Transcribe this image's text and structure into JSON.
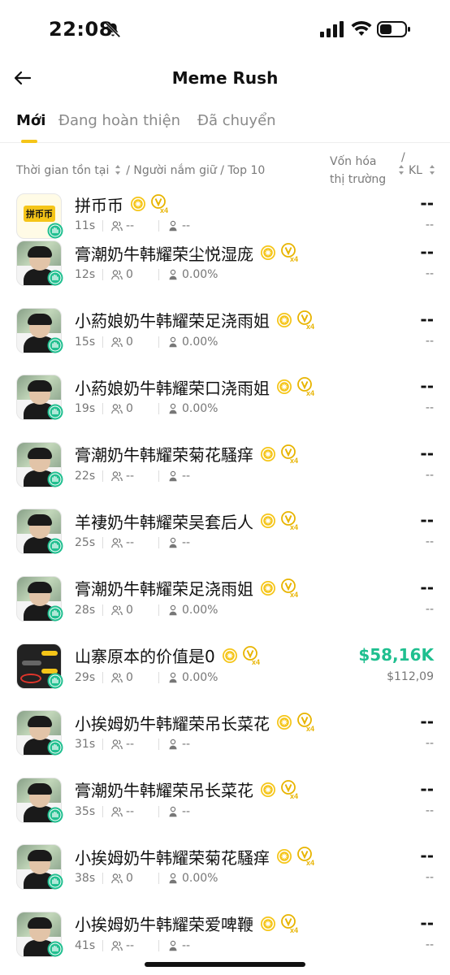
{
  "status": {
    "time": "22:08"
  },
  "header": {
    "title": "Meme Rush"
  },
  "tabs": [
    {
      "label": "Mới",
      "active": true
    },
    {
      "label": "Đang hoàn thiện",
      "active": false
    },
    {
      "label": "Đã chuyển",
      "active": false
    }
  ],
  "columns": {
    "sort_left_1": "Thời gian tồn tại",
    "sort_left_2": "/ Người nắm giữ / Top 10",
    "mcap_line1": "Vốn hóa",
    "mcap_line2": "thị trường",
    "slash": "/",
    "vol": "KL"
  },
  "tokens": [
    {
      "name": "拼币币",
      "age": "11s",
      "holders": "--",
      "top10": "--",
      "mcap": "--",
      "vol": "--",
      "avatar": "logo",
      "avatar_text": "拼币币"
    },
    {
      "name": "膏潮奶牛韩耀荣尘悦湿庞",
      "age": "12s",
      "holders": "0",
      "top10": "0.00%",
      "mcap": "--",
      "vol": "--",
      "avatar": "person"
    },
    {
      "name": "小葯娘奶牛韩耀荣足浇雨姐",
      "age": "15s",
      "holders": "0",
      "top10": "0.00%",
      "mcap": "--",
      "vol": "--",
      "avatar": "person"
    },
    {
      "name": "小葯娘奶牛韩耀荣口浇雨姐",
      "age": "19s",
      "holders": "0",
      "top10": "0.00%",
      "mcap": "--",
      "vol": "--",
      "avatar": "person"
    },
    {
      "name": "膏潮奶牛韩耀荣菊花騷痒",
      "age": "22s",
      "holders": "--",
      "top10": "--",
      "mcap": "--",
      "vol": "--",
      "avatar": "person"
    },
    {
      "name": "羊褄奶牛韩耀荣吴套后人",
      "age": "25s",
      "holders": "--",
      "top10": "--",
      "mcap": "--",
      "vol": "--",
      "avatar": "person"
    },
    {
      "name": "膏潮奶牛韩耀荣足浇雨姐",
      "age": "28s",
      "holders": "0",
      "top10": "0.00%",
      "mcap": "--",
      "vol": "--",
      "avatar": "person"
    },
    {
      "name": "山寨原本的价值是0",
      "age": "29s",
      "holders": "0",
      "top10": "0.00%",
      "mcap": "$58,16K",
      "vol": "$112,09",
      "avatar": "chat",
      "up": true
    },
    {
      "name": "小挨姆奶牛韩耀荣吊长菜花",
      "age": "31s",
      "holders": "--",
      "top10": "--",
      "mcap": "--",
      "vol": "--",
      "avatar": "person"
    },
    {
      "name": "膏潮奶牛韩耀荣吊长菜花",
      "age": "35s",
      "holders": "--",
      "top10": "--",
      "mcap": "--",
      "vol": "--",
      "avatar": "person"
    },
    {
      "name": "小挨姆奶牛韩耀荣菊花騷痒",
      "age": "38s",
      "holders": "0",
      "top10": "0.00%",
      "mcap": "--",
      "vol": "--",
      "avatar": "person"
    },
    {
      "name": "小挨姆奶牛韩耀荣爱啤鞭",
      "age": "41s",
      "holders": "--",
      "top10": "--",
      "mcap": "--",
      "vol": "--",
      "avatar": "person"
    }
  ],
  "colors": {
    "accent": "#f5c518",
    "up": "#1fbf8f",
    "badge": "#1fbf8f"
  },
  "icons": {
    "coin": "coin-icon",
    "vx": "v-x4-icon",
    "holders": "holders-icon",
    "top10": "person-icon"
  }
}
